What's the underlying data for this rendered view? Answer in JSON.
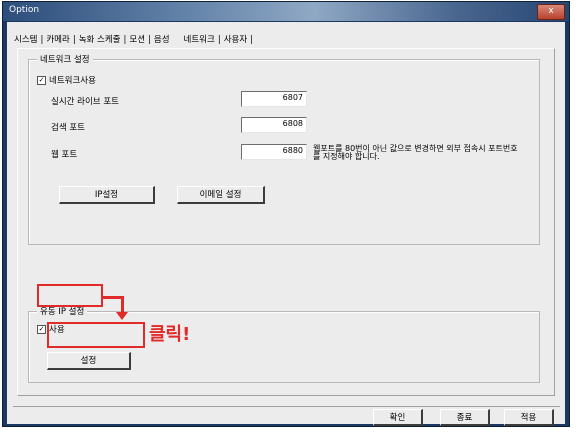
{
  "window": {
    "title": "Option",
    "close": "x"
  },
  "tabs": [
    "시스템",
    "카메라",
    "녹화 스케줄",
    "모션",
    "음성",
    "네트워크",
    "사용자"
  ],
  "active_tab": "네트워크",
  "network_group": {
    "legend": "네트워크 설정",
    "use_network": {
      "label": "네트워크사용",
      "checked": "✓"
    },
    "live_port": {
      "label": "실시간 라이브 포트",
      "value": "6807"
    },
    "search_port": {
      "label": "검색 포트",
      "value": "6808"
    },
    "web_port": {
      "label": "웹 포트",
      "value": "6880"
    },
    "web_port_note_line1": "웹포트를 80번이 아닌 값으로 변경하면 외부 접속시 포트번호",
    "web_port_note_line2": "를 지정해야 합니다.",
    "ip_button": "IP설정",
    "email_button": "이메일 설정"
  },
  "dynamic_ip_group": {
    "legend": "유동 IP 설정",
    "use": {
      "label": "사용",
      "checked": "✓"
    },
    "settings_button": "설정"
  },
  "annotation": {
    "text": "클릭!",
    "color": "#e12a2a"
  },
  "footer": {
    "ok": "확인",
    "close": "종료",
    "apply": "적용"
  }
}
